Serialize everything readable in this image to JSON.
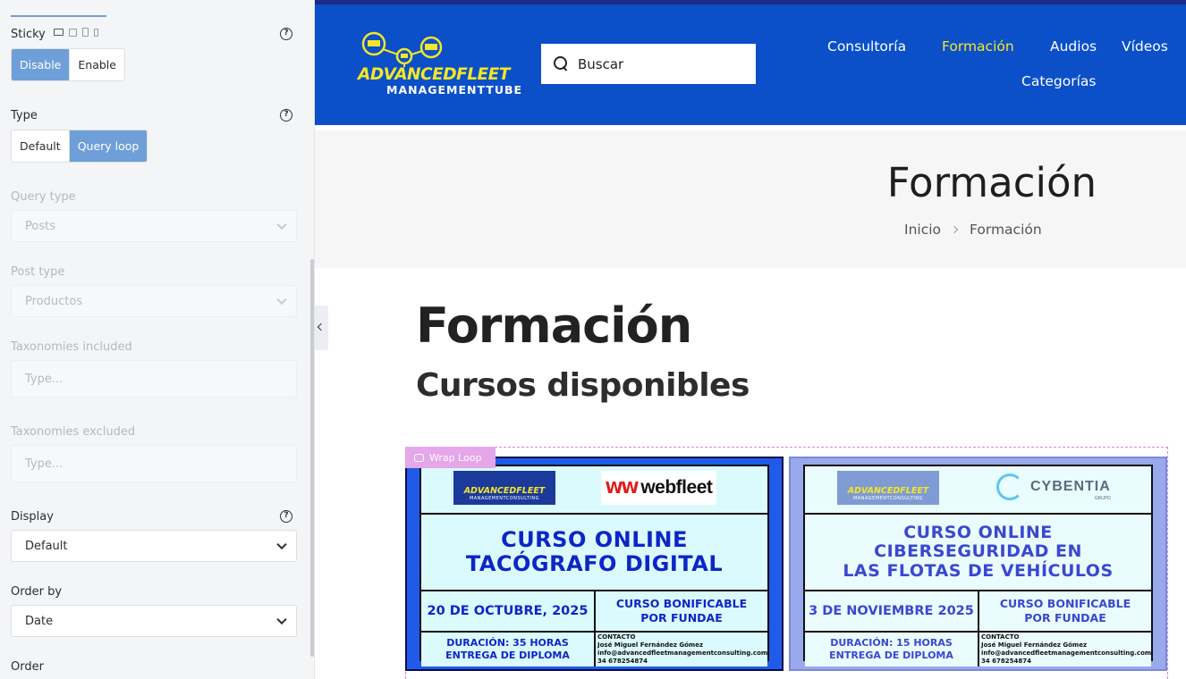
{
  "panel": {
    "sticky": {
      "label": "Sticky",
      "options": [
        "Disable",
        "Enable"
      ],
      "selected": "Disable"
    },
    "type": {
      "label": "Type",
      "options": [
        "Default",
        "Query loop"
      ],
      "selected": "Query loop"
    },
    "query_type": {
      "label": "Query type",
      "value": "Posts"
    },
    "post_type": {
      "label": "Post type",
      "value": "Productos"
    },
    "taxonomies_included": {
      "label": "Taxonomies included",
      "placeholder": "Type..."
    },
    "taxonomies_excluded": {
      "label": "Taxonomies excluded",
      "placeholder": "Type..."
    },
    "display": {
      "label": "Display",
      "value": "Default"
    },
    "order_by": {
      "label": "Order by",
      "value": "Date"
    },
    "order": {
      "label": "Order"
    },
    "help_glyph": "?"
  },
  "site": {
    "logo": {
      "line1": "ADVANCEDFLEET",
      "line2": "MANAGEMENTTUBE"
    },
    "search": {
      "placeholder": "Buscar"
    },
    "nav": [
      {
        "label": "Consultoría"
      },
      {
        "label": "Formación",
        "current": true
      },
      {
        "label": "Audios"
      },
      {
        "label": "Vídeos"
      },
      {
        "label": "Categorías"
      }
    ],
    "accent_color": "#f4e628",
    "header_color": "#0b50c9"
  },
  "page": {
    "title": "Formación",
    "breadcrumb": [
      "Inicio",
      "Formación"
    ],
    "heading": "Formación",
    "subheading": "Cursos disponibles"
  },
  "loop": {
    "tag": "Wrap Loop",
    "cards": [
      {
        "logo_a": "ADVANCEDFLEET",
        "logo_b": "MANAGEMENTCONSULTING",
        "partner": "webfleet",
        "headline": [
          "CURSO ONLINE",
          "TACÓGRAFO DIGITAL"
        ],
        "date": "20 DE OCTUBRE, 2025",
        "bonif": [
          "CURSO BONIFICABLE",
          "POR FUNDAE"
        ],
        "duration": [
          "DURACIÓN: 35 HORAS",
          "ENTREGA DE DIPLOMA"
        ],
        "contact": [
          "CONTACTO",
          "José Miguel Fernández Gómez",
          "info@advancedfleetmanagementconsulting.com",
          "34 678254874"
        ]
      },
      {
        "logo_a": "ADVANCEDFLEET",
        "logo_b": "MANAGEMENTCONSULTING",
        "partner": "CYBENTIA",
        "partner_sub": "GRUPO",
        "headline": [
          "CURSO ONLINE",
          "CIBERSEGURIDAD EN",
          "LAS FLOTAS DE VEHÍCULOS"
        ],
        "date": "3 DE NOVIEMBRE 2025",
        "bonif": [
          "CURSO BONIFICABLE",
          "POR FUNDAE"
        ],
        "duration": [
          "DURACIÓN: 15 HORAS",
          "ENTREGA DE DIPLOMA"
        ],
        "contact": [
          "CONTACTO",
          "José Miguel Fernández Gómez",
          "info@advancedfleetmanagementconsulting.com",
          "34 678254874"
        ]
      }
    ]
  }
}
